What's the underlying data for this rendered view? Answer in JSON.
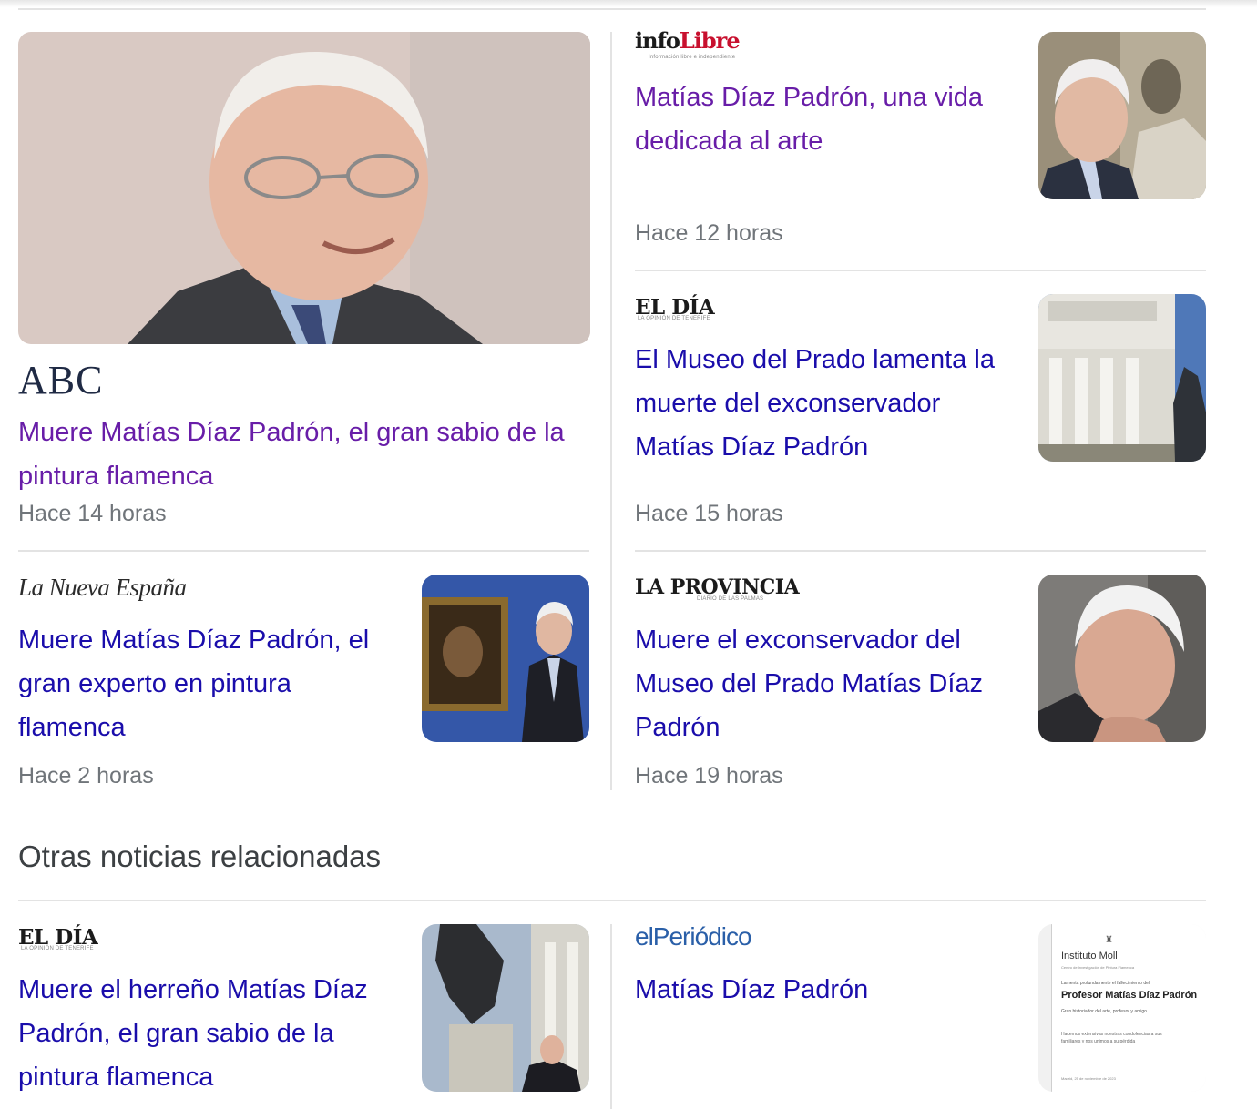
{
  "section_title": "Otras noticias relacionadas",
  "articles": [
    {
      "source": "ABC",
      "headline": "Muere Matías Díaz Padrón, el gran sabio de la pintura flamenca",
      "time": "Hace 14 horas",
      "image": "portrait-elderly-man-smiling"
    },
    {
      "source_a": "info",
      "source_b": "Libre",
      "tagline": "Información libre e independiente",
      "headline": "Matías Díaz Padrón, una vida dedicada al arte",
      "time": "Hace 12 horas",
      "image": "portrait-man-with-painting"
    },
    {
      "source": "EL DÍA",
      "tagline": "LA OPINIÓN DE TENERIFE",
      "headline": "El Museo del Prado lamenta la muerte del exconservador Matías Díaz Padrón",
      "time": "Hace 15 horas",
      "image": "museo-del-prado-facade"
    },
    {
      "source": "La Nueva España",
      "headline": "Muere Matías Díaz Padrón, el gran experto en pintura flamenca",
      "time": "Hace 2 horas",
      "image": "man-beside-framed-painting"
    },
    {
      "source": "LA PROVINCIA",
      "tagline": "DIARIO DE LAS PALMAS",
      "headline": "Muere el exconservador del Museo del Prado Matías Díaz Padrón",
      "time": "Hace 19 horas",
      "image": "portrait-man-hand-on-chin"
    },
    {
      "source": "EL DÍA",
      "tagline": "LA OPINIÓN DE TENERIFE",
      "headline": "Muere el herreño Matías Díaz Padrón, el gran sabio de la pintura flamenca",
      "image": "statue-and-man"
    },
    {
      "source": "elPeriódico",
      "headline": "Matías Díaz Padrón",
      "image": "obituary-notice"
    }
  ],
  "obituary": {
    "institution": "Instituto Moll",
    "subtitle": "Centro de Investigación de Pintura Flamenca",
    "lament": "Lamenta profundamente el fallecimiento del",
    "name": "Profesor Matías Díaz Padrón",
    "role": "Gran historiador del arte, profesor y amigo",
    "condolences": "Hacemos extensivas nuestras condolencias a sus familiares y nos unimos a su pérdida",
    "date": "Madrid, 25 de noviembre de 2023"
  },
  "colors": {
    "link": "#1a0dab",
    "visited": "#681da8",
    "meta": "#70757a",
    "divider": "#e3e3e3"
  }
}
